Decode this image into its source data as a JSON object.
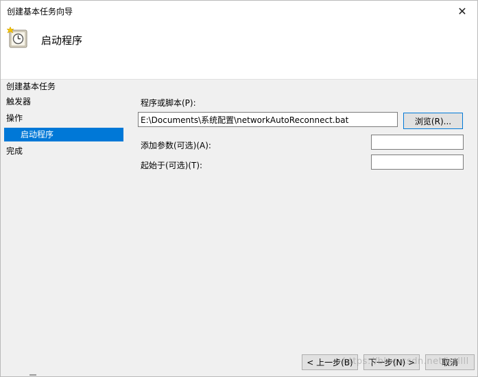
{
  "window": {
    "title": "创建基本任务向导",
    "close_glyph": "✕"
  },
  "header": {
    "icon": "scheduled-task-clock-icon",
    "title": "启动程序"
  },
  "nav": {
    "items": [
      {
        "label": "创建基本任务"
      },
      {
        "label": "触发器"
      },
      {
        "label": "操作"
      },
      {
        "label": "启动程序"
      },
      {
        "label": "完成"
      }
    ]
  },
  "form": {
    "program_label": "程序或脚本(P):",
    "program_value": "E:\\Documents\\系统配置\\networkAutoReconnect.bat",
    "browse_label": "浏览(R)...",
    "args_label": "添加参数(可选)(A):",
    "args_value": "",
    "startin_label": "起始于(可选)(T):",
    "startin_value": ""
  },
  "footer": {
    "back_label": "< 上一步(B)",
    "next_label": "下一步(N) >",
    "cancel_label": "取消",
    "watermark": "https://blog.csdn.net/ballll"
  },
  "colors": {
    "selection": "#0078d7",
    "content_bg": "#f0f0f0",
    "button_bg": "#e1e1e1"
  }
}
